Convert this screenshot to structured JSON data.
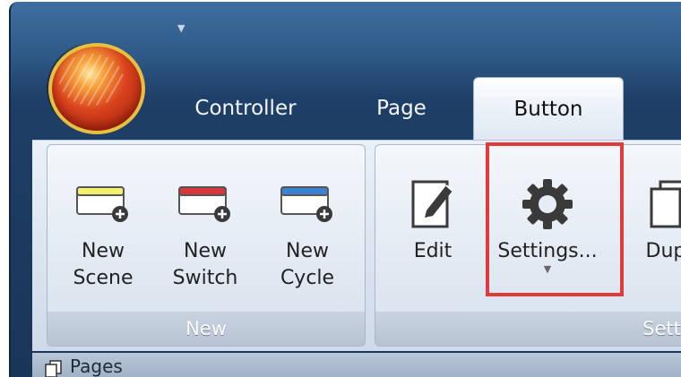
{
  "qat": {
    "dropdown_glyph": "▼"
  },
  "app_orb": {
    "icon": "app-orb-ball-icon"
  },
  "tabs": [
    {
      "label": "Controller",
      "active": false
    },
    {
      "label": "Page",
      "active": false
    },
    {
      "label": "Button",
      "active": true
    }
  ],
  "ribbon": {
    "groups": [
      {
        "label": "New",
        "buttons": [
          {
            "line1": "New",
            "line2": "Scene",
            "icon": "new-scene-icon",
            "color": "#f2f06a"
          },
          {
            "line1": "New",
            "line2": "Switch",
            "icon": "new-switch-icon",
            "color": "#d8383c"
          },
          {
            "line1": "New",
            "line2": "Cycle",
            "icon": "new-cycle-icon",
            "color": "#3b82d6"
          }
        ]
      },
      {
        "label": "Settin",
        "buttons": [
          {
            "label": "Edit",
            "icon": "edit-icon"
          },
          {
            "label": "Settings...",
            "icon": "gear-icon",
            "highlighted": true,
            "has_dropdown": true
          },
          {
            "label": "Dupl",
            "icon": "duplicate-icon"
          }
        ]
      }
    ]
  },
  "bottom": {
    "panel_title": "Pages"
  },
  "colors": {
    "highlight": "#e03b3b",
    "title_bar": "#2f5a88"
  }
}
